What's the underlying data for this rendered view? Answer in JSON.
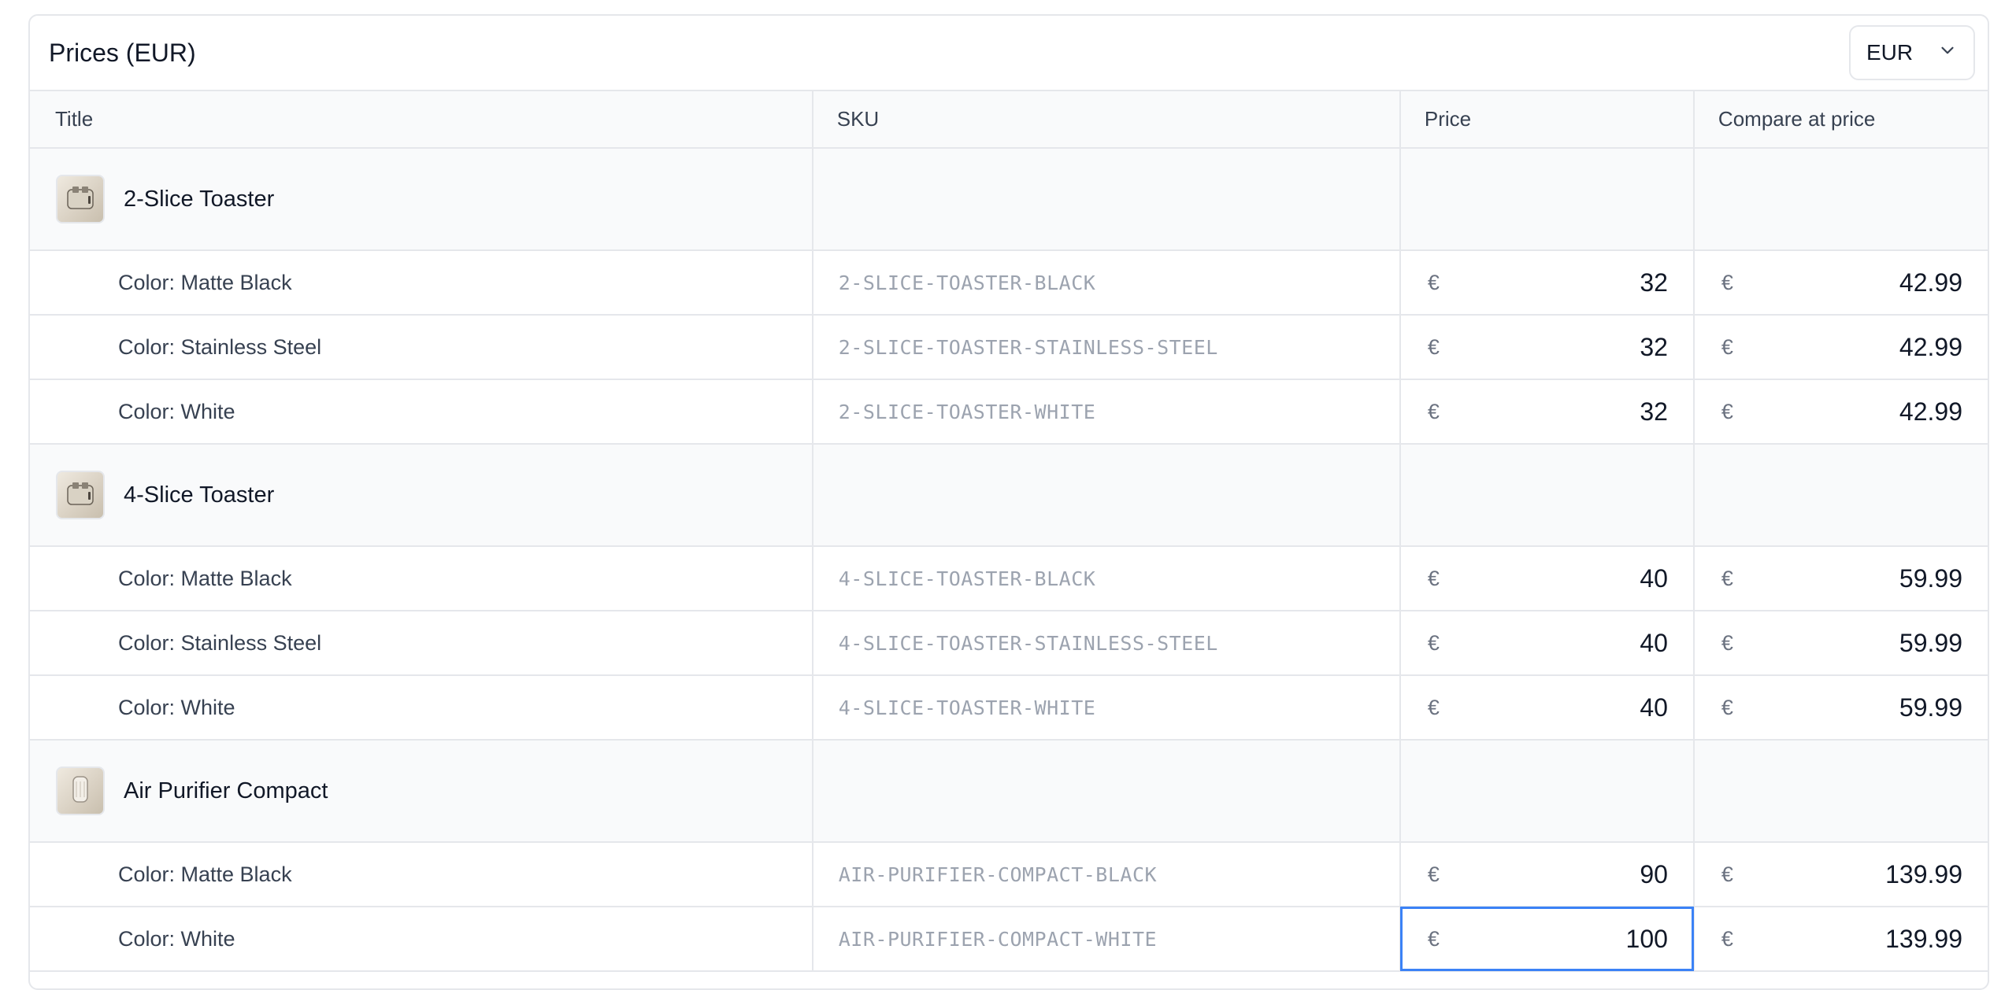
{
  "header": {
    "title": "Prices (EUR)",
    "currency_select": {
      "value": "EUR",
      "icon": "chevron-down-icon"
    }
  },
  "table": {
    "columns": [
      "Title",
      "SKU",
      "Price",
      "Compare at price"
    ],
    "currency_symbol": "€",
    "products": [
      {
        "name": "2-Slice Toaster",
        "thumbnail_icon": "toaster-icon",
        "variants": [
          {
            "title": "Color: Matte Black",
            "sku": "2-SLICE-TOASTER-BLACK",
            "price": "32",
            "compare_at": "42.99"
          },
          {
            "title": "Color: Stainless Steel",
            "sku": "2-SLICE-TOASTER-STAINLESS-STEEL",
            "price": "32",
            "compare_at": "42.99"
          },
          {
            "title": "Color: White",
            "sku": "2-SLICE-TOASTER-WHITE",
            "price": "32",
            "compare_at": "42.99"
          }
        ]
      },
      {
        "name": "4-Slice Toaster",
        "thumbnail_icon": "toaster-icon",
        "variants": [
          {
            "title": "Color: Matte Black",
            "sku": "4-SLICE-TOASTER-BLACK",
            "price": "40",
            "compare_at": "59.99"
          },
          {
            "title": "Color: Stainless Steel",
            "sku": "4-SLICE-TOASTER-STAINLESS-STEEL",
            "price": "40",
            "compare_at": "59.99"
          },
          {
            "title": "Color: White",
            "sku": "4-SLICE-TOASTER-WHITE",
            "price": "40",
            "compare_at": "59.99"
          }
        ]
      },
      {
        "name": "Air Purifier Compact",
        "thumbnail_icon": "air-purifier-icon",
        "variants": [
          {
            "title": "Color: Matte Black",
            "sku": "AIR-PURIFIER-COMPACT-BLACK",
            "price": "90",
            "compare_at": "139.99"
          },
          {
            "title": "Color: White",
            "sku": "AIR-PURIFIER-COMPACT-WHITE",
            "price": "100",
            "compare_at": "139.99",
            "focused": true
          }
        ]
      }
    ]
  },
  "colors": {
    "focus_border": "#3b82f6",
    "header_bg": "#f9fafb",
    "border": "#e5e7eb",
    "sku_text": "#9ca3af"
  }
}
